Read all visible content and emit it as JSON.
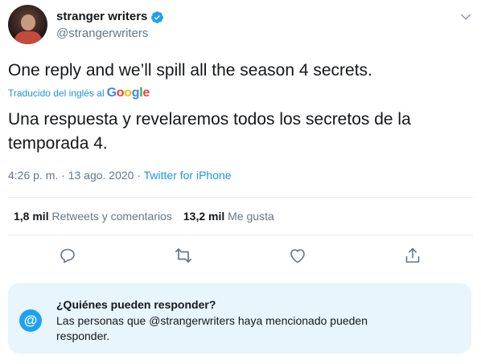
{
  "author": {
    "display_name": "stranger writers",
    "handle": "@strangerwriters"
  },
  "tweet": {
    "text": "One reply and we’ll spill all the season 4 secrets.",
    "translated_label": "Traducido del inglés al",
    "translator_logo": "Google",
    "translation": "Una respuesta y revelaremos todos los secretos de la temporada 4.",
    "timestamp": "4:26 p. m. · 13 ago. 2020 · ",
    "source": "Twitter for iPhone"
  },
  "stats": {
    "retweets_count": "1,8 mil",
    "retweets_label": "Retweets y comentarios",
    "likes_count": "13,2 mil",
    "likes_label": "Me gusta"
  },
  "actions": [
    "reply-icon",
    "retweet-icon",
    "like-icon",
    "share-icon"
  ],
  "conversation": {
    "title": "¿Quiénes pueden responder?",
    "description": "Las personas que @strangerwriters haya mencionado pueden responder."
  },
  "colors": {
    "accent": "#1da1f2",
    "link": "#1b95e0",
    "muted": "#657786",
    "text": "#14171a",
    "box_bg": "#e8f5fd"
  }
}
